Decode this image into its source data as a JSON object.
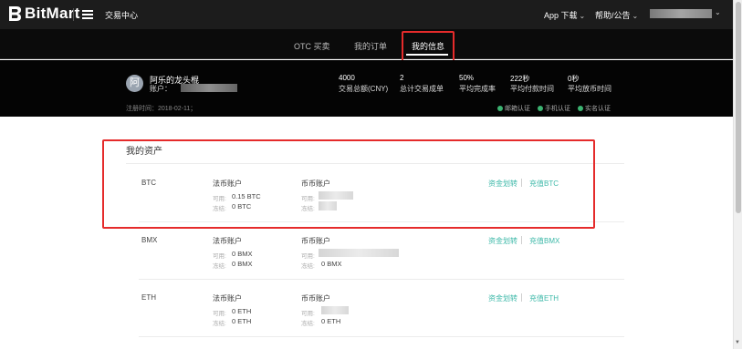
{
  "header": {
    "logo_text": "BitMart",
    "trade_center": "交易中心",
    "app_download": "App 下载",
    "help_notice": "帮助/公告"
  },
  "subnav": {
    "tabs": [
      {
        "label": "OTC 买卖"
      },
      {
        "label": "我的订单"
      },
      {
        "label": "我的信息"
      }
    ],
    "active_index": 2
  },
  "profile": {
    "avatar_char": "阿",
    "nickname": "阿乐的龙头棍",
    "account_label": "账户：",
    "register_time": "注册时间：2018-02-11；",
    "stats": [
      {
        "value": "4000",
        "label": "交易总额(CNY)"
      },
      {
        "value": "2",
        "label": "总计交易成单"
      },
      {
        "value": "50%",
        "label": "平均完成率"
      },
      {
        "value": "222秒",
        "label": "平均付款时间"
      },
      {
        "value": "0秒",
        "label": "平均放币时间"
      }
    ],
    "verifications": [
      "邮箱认证",
      "手机认证",
      "实名认证"
    ]
  },
  "assets": {
    "title": "我的资产",
    "fiat_header": "法币账户",
    "coin_header": "币币账户",
    "available_label": "可用:",
    "frozen_label": "冻结:",
    "transfer_link": "资金划转",
    "rows": [
      {
        "coin": "BTC",
        "fiat_available": "0.15 BTC",
        "fiat_frozen": "0 BTC",
        "coin_frozen": "",
        "deposit_link": "充值BTC"
      },
      {
        "coin": "BMX",
        "fiat_available": "0 BMX",
        "fiat_frozen": "0 BMX",
        "coin_frozen": "0 BMX",
        "deposit_link": "充值BMX"
      },
      {
        "coin": "ETH",
        "fiat_available": "0 ETH",
        "fiat_frozen": "0 ETH",
        "coin_frozen": "0 ETH",
        "deposit_link": "充值ETH"
      }
    ]
  },
  "colors": {
    "topbar_bg": "#1c1c1c",
    "profile_bg": "#040404",
    "highlight_red": "#e52b2b",
    "link_teal": "#3cb8a8",
    "verify_green": "#3cb371"
  }
}
